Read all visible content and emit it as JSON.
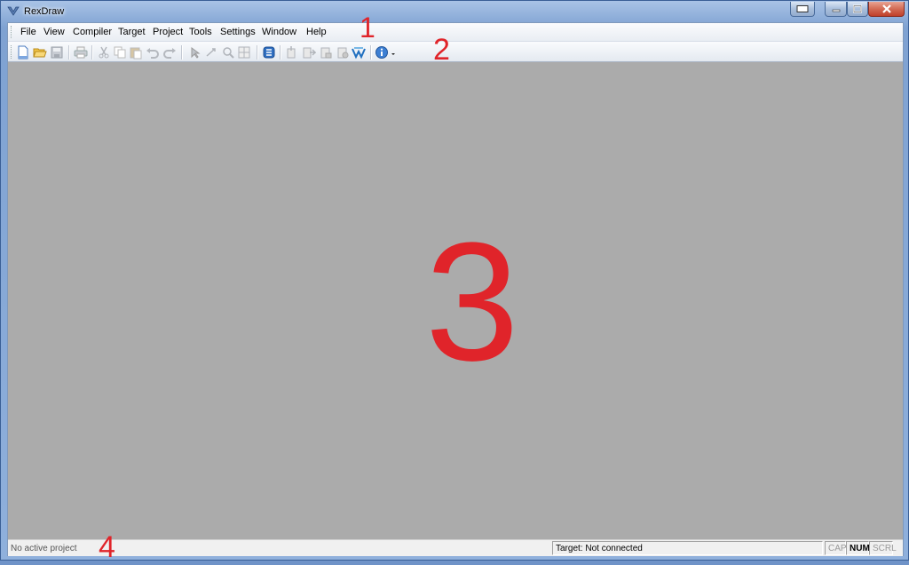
{
  "window": {
    "title": "RexDraw"
  },
  "menubar": {
    "items": [
      "File",
      "View",
      "Compiler",
      "Target",
      "Project",
      "Tools",
      "Settings",
      "Window",
      "Help"
    ]
  },
  "toolbar": {
    "icons": [
      "new-icon",
      "open-icon",
      "save-icon",
      "print-icon",
      "cut-icon",
      "copy-icon",
      "paste-icon",
      "undo-icon",
      "redo-icon",
      "pointer-icon",
      "connect-icon",
      "zoom-icon",
      "grid-icon",
      "compile-icon",
      "upload-icon",
      "download-icon",
      "lock-icon",
      "stop-icon",
      "watch-icon",
      "info-icon",
      "dropdown-arrow-icon"
    ]
  },
  "statusbar": {
    "project": "No active project",
    "target": "Target: Not connected",
    "cap": "CAP",
    "num": "NUM",
    "scrl": "SCRL"
  },
  "callouts": {
    "c1": "1",
    "c2": "2",
    "c3": "3",
    "c4": "4"
  },
  "colors": {
    "callout": "#e0242a",
    "workspace": "#ababab"
  }
}
